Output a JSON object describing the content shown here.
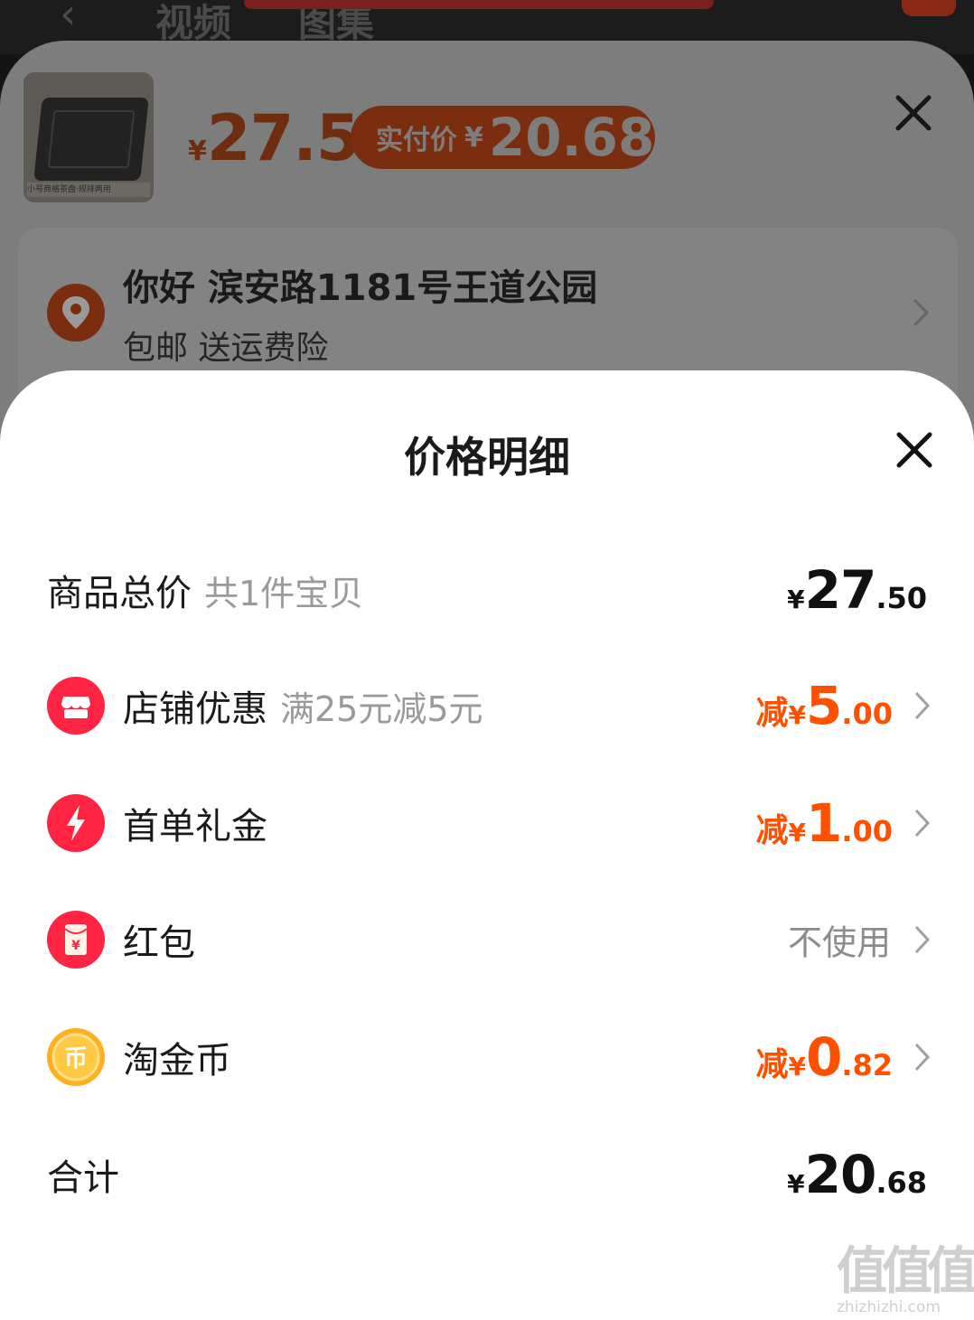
{
  "background": {
    "tabs": [
      "视频",
      "图集"
    ],
    "sku_price": {
      "currency": "¥",
      "value": "27.5"
    },
    "actual_price": {
      "label": "实付价",
      "currency": "¥",
      "value": "20.68"
    },
    "thumbnail_caption": "小号商格茶盘·规排两用",
    "address": {
      "line1": "你好 滨安路1181号王道公园",
      "line2": "包邮 送运费险"
    }
  },
  "sheet": {
    "title": "价格明细",
    "rows": [
      {
        "label": "商品总价",
        "sub": "共1件宝贝",
        "currency": "¥",
        "int": "27",
        "dec": ".50"
      },
      {
        "label": "店铺优惠",
        "sub": "满25元减5元",
        "prefix": "减",
        "currency": "¥",
        "int": "5",
        "dec": ".00"
      },
      {
        "label": "首单礼金",
        "prefix": "减",
        "currency": "¥",
        "int": "1",
        "dec": ".00"
      },
      {
        "label": "红包",
        "value_text": "不使用"
      },
      {
        "label": "淘金币",
        "prefix": "减",
        "currency": "¥",
        "int": "0",
        "dec": ".82"
      },
      {
        "label": "合计",
        "currency": "¥",
        "int": "20",
        "dec": ".68"
      }
    ]
  },
  "watermark": {
    "mark": "值值值",
    "url": "zhizhizhi.com"
  },
  "colors": {
    "accent": "#ff5000",
    "shop_red": "#ff2442",
    "coin_gold": "#ffb020"
  },
  "icons": [
    "shop-icon",
    "lightning-icon",
    "red-envelope-icon",
    "gold-coin-icon",
    "location-pin-icon",
    "close-icon",
    "chevron-right-icon"
  ]
}
